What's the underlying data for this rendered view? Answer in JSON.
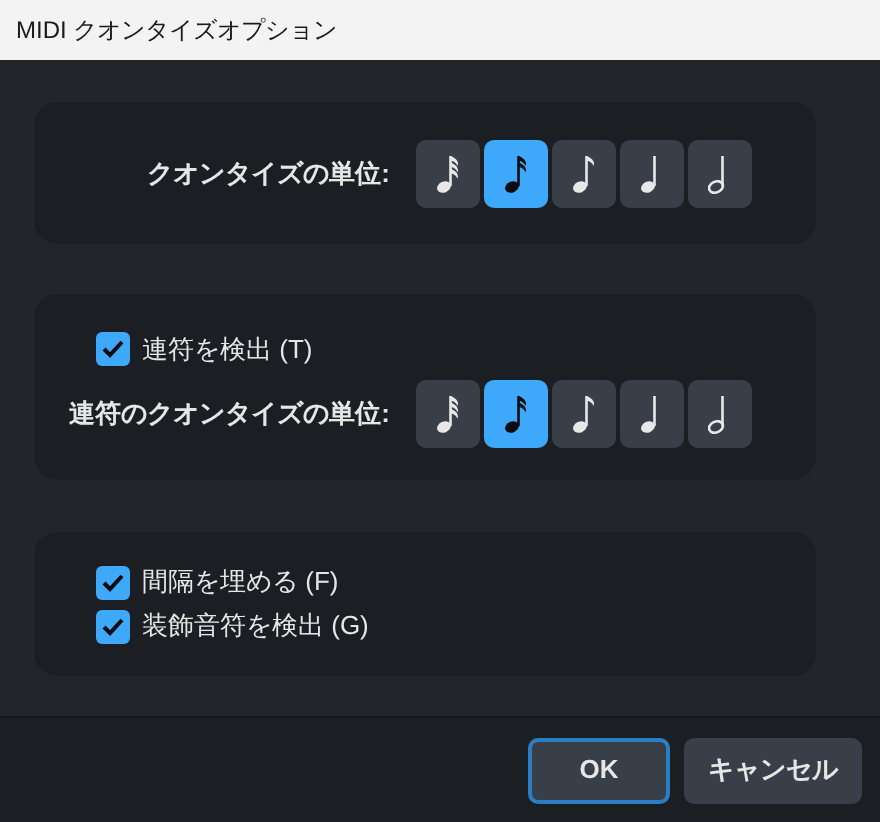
{
  "window": {
    "title": "MIDI クオンタイズオプション"
  },
  "quantize": {
    "label": "クオンタイズの単位:",
    "units": [
      {
        "kind": "thirty-second",
        "selected": false
      },
      {
        "kind": "sixteenth",
        "selected": true
      },
      {
        "kind": "eighth",
        "selected": false
      },
      {
        "kind": "quarter",
        "selected": false
      },
      {
        "kind": "half",
        "selected": false
      }
    ]
  },
  "tuplets": {
    "detect": {
      "label": "連符を検出 (T)",
      "checked": true
    },
    "label": "連符のクオンタイズの単位:",
    "units": [
      {
        "kind": "thirty-second",
        "selected": false
      },
      {
        "kind": "sixteenth",
        "selected": true
      },
      {
        "kind": "eighth",
        "selected": false
      },
      {
        "kind": "quarter",
        "selected": false
      },
      {
        "kind": "half",
        "selected": false
      }
    ]
  },
  "options": [
    {
      "label": "間隔を埋める (F)",
      "checked": true
    },
    {
      "label": "装飾音符を検出 (G)",
      "checked": true
    }
  ],
  "buttons": [
    {
      "label": "OK",
      "default": true
    },
    {
      "label": "キャンセル",
      "default": false
    }
  ]
}
